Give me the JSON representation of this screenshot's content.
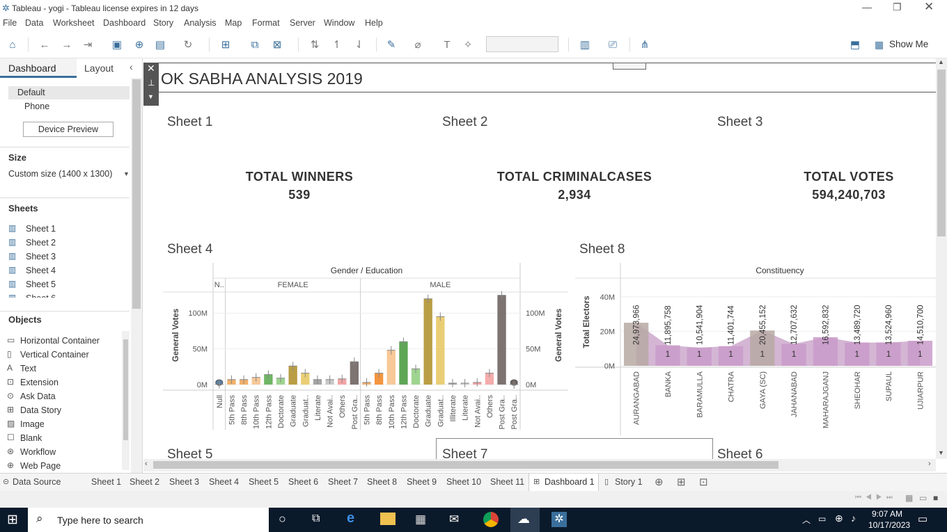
{
  "window": {
    "title": "Tableau - yogi - Tableau license expires in 12 days"
  },
  "menu": [
    "File",
    "Data",
    "Worksheet",
    "Dashboard",
    "Story",
    "Analysis",
    "Map",
    "Format",
    "Server",
    "Window",
    "Help"
  ],
  "toolbar": {
    "show_me": "Show Me"
  },
  "left": {
    "tab_dashboard": "Dashboard",
    "tab_layout": "Layout",
    "device_default": "Default",
    "device_phone": "Phone",
    "device_preview": "Device Preview",
    "size_heading": "Size",
    "size_value": "Custom size (1400 x 1300)",
    "sheets_heading": "Sheets",
    "sheets": [
      "Sheet 1",
      "Sheet 2",
      "Sheet 3",
      "Sheet 4",
      "Sheet 5",
      "Sheet 6"
    ],
    "objects_heading": "Objects",
    "objects": [
      "Horizontal Container",
      "Vertical Container",
      "Text",
      "Extension",
      "Ask Data",
      "Data Story",
      "Image",
      "Blank",
      "Workflow",
      "Web Page"
    ]
  },
  "dashboard": {
    "title": "OK SABHA ANALYSIS 2019",
    "kpis": [
      {
        "sheet": "Sheet 1",
        "label": "TOTAL WINNERS",
        "value": "539"
      },
      {
        "sheet": "Sheet 2",
        "label": "TOTAL CRIMINALCASES",
        "value": "2,934"
      },
      {
        "sheet": "Sheet 3",
        "label": "TOTAL VOTES",
        "value": "594,240,703"
      }
    ],
    "sheet4_title": "Sheet 4",
    "sheet8_title": "Sheet 8",
    "bottom_titles": [
      "Sheet 5",
      "Sheet 7",
      "Sheet 6"
    ]
  },
  "chart_data": [
    {
      "type": "bar",
      "header": "Gender / Education",
      "groups": [
        "N..",
        "FEMALE",
        "MALE"
      ],
      "ylabel": "General Votes",
      "yticks": [
        "0M",
        "50M",
        "100M"
      ],
      "ylim": [
        0,
        145
      ],
      "categories": [
        "Null",
        "5th Pass",
        "8th Pass",
        "10th Pass",
        "12th Pass",
        "Doctorate",
        "Graduate",
        "Graduat..",
        "Literate",
        "Not Avai..",
        "Others",
        "Post Gra..",
        "5th Pass",
        "8th Pass",
        "10th Pass",
        "12th Pass",
        "Doctorate",
        "Graduate",
        "Graduat..",
        "Illiterate",
        "Literate",
        "Not Avai..",
        "Others",
        "Post Gra..",
        "Post Gra.."
      ],
      "values": [
        0.5,
        7,
        7,
        10,
        14,
        9,
        26,
        16,
        7,
        7,
        8,
        32,
        3,
        16,
        48,
        60,
        22,
        120,
        95,
        2,
        2,
        3,
        16,
        125,
        0
      ],
      "colors": [
        "#5b7fa6",
        "#f2a85b",
        "#f2a85b",
        "#f7c28d",
        "#5fae54",
        "#93cf84",
        "#b29431",
        "#e8c966",
        "#9c9c9c",
        "#c2c2c2",
        "#f49a9a",
        "#6f6461",
        "#f2a85b",
        "#f28a2a",
        "#f7c28d",
        "#4e9d45",
        "#93cf84",
        "#b29431",
        "#e8c966",
        "#9c9c9c",
        "#c2c2c2",
        "#f49a9a",
        "#f4a3a3",
        "#6f6461",
        "#6f6461"
      ]
    },
    {
      "type": "bar",
      "header": "Constituency",
      "ylabel": "Total Electors",
      "yticks": [
        "0M",
        "20M",
        "40M"
      ],
      "ylim": [
        0,
        50
      ],
      "categories": [
        "AURANGABAD",
        "BANKA",
        "BARAMULLA",
        "CHATRA",
        "GAYA (SC)",
        "JAHANABAD",
        "MAHARAJGANJ",
        "SHEOHAR",
        "SUPAUL",
        "UJIARPUR"
      ],
      "values": [
        24.97,
        11.9,
        10.54,
        11.4,
        20.46,
        12.71,
        16.59,
        13.49,
        13.52,
        14.51
      ],
      "bar_labels": [
        "24,973,966",
        "11,895,758",
        "10,541,904",
        "11,401,744",
        "20,455,152",
        "12,707,632",
        "16,592,832",
        "13,489,720",
        "13,524,960",
        "14,510,700"
      ],
      "counts": [
        "",
        "1",
        "1",
        "1",
        "1",
        "1",
        "",
        "1",
        "1",
        "1"
      ]
    }
  ],
  "tabs": [
    "Data Source",
    "Sheet 1",
    "Sheet 2",
    "Sheet 3",
    "Sheet 4",
    "Sheet 5",
    "Sheet 6",
    "Sheet 7",
    "Sheet 8",
    "Sheet 9",
    "Sheet 10",
    "Sheet 11",
    "Dashboard 1",
    "Story 1"
  ],
  "taskbar": {
    "search": "Type here to search",
    "time": "9:07 AM",
    "date": "10/17/2023"
  }
}
